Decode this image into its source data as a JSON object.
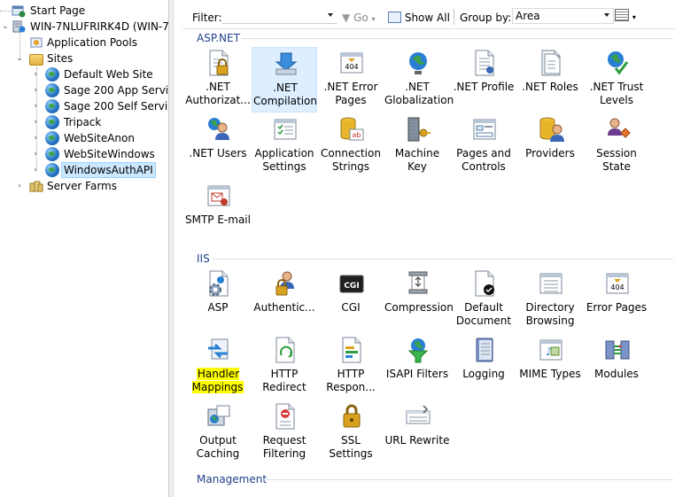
{
  "tree": {
    "nodes": [
      {
        "label": "Start Page"
      },
      {
        "label": "WIN-7NLUFRIRK4D (WIN-7NL"
      },
      {
        "label": "Application Pools"
      },
      {
        "label": "Sites"
      },
      {
        "label": "Default Web Site"
      },
      {
        "label": "Sage 200 App Services"
      },
      {
        "label": "Sage 200 Self Service"
      },
      {
        "label": "Tripack"
      },
      {
        "label": "WebSiteAnon"
      },
      {
        "label": "WebSiteWindows"
      },
      {
        "label": "WindowsAuthAPI"
      },
      {
        "label": "Server Farms"
      }
    ],
    "selected": "WindowsAuthAPI"
  },
  "filterbar": {
    "filter_label": "Filter:",
    "filter_value": "",
    "go_label": "Go",
    "show_all_label": "Show All",
    "group_by_label": "Group by:",
    "group_by_value": "Area"
  },
  "groups": {
    "aspnet": {
      "title": "ASP.NET",
      "items": [
        {
          "cap": ".NET Authorizat...",
          "icon": "lock-doc-icon"
        },
        {
          "cap": ".NET Compilation",
          "icon": "compile-icon"
        },
        {
          "cap": ".NET Error Pages",
          "icon": "error-404-icon"
        },
        {
          "cap": ".NET Globalization",
          "icon": "globe-icon"
        },
        {
          "cap": ".NET Profile",
          "icon": "profile-icon"
        },
        {
          "cap": ".NET Roles",
          "icon": "roles-icon"
        },
        {
          "cap": ".NET Trust Levels",
          "icon": "trust-icon"
        },
        {
          "cap": ".NET Users",
          "icon": "users-icon"
        },
        {
          "cap": "Application Settings",
          "icon": "app-settings-icon"
        },
        {
          "cap": "Connection Strings",
          "icon": "connection-icon"
        },
        {
          "cap": "Machine Key",
          "icon": "machine-key-icon"
        },
        {
          "cap": "Pages and Controls",
          "icon": "pages-controls-icon"
        },
        {
          "cap": "Providers",
          "icon": "providers-icon"
        },
        {
          "cap": "Session State",
          "icon": "session-state-icon"
        },
        {
          "cap": "SMTP E-mail",
          "icon": "smtp-icon"
        }
      ]
    },
    "iis": {
      "title": "IIS",
      "items": [
        {
          "cap": "ASP",
          "icon": "asp-icon"
        },
        {
          "cap": "Authentic...",
          "icon": "authentication-icon"
        },
        {
          "cap": "CGI",
          "icon": "cgi-icon"
        },
        {
          "cap": "Compression",
          "icon": "compression-icon"
        },
        {
          "cap": "Default Document",
          "icon": "default-document-icon"
        },
        {
          "cap": "Directory Browsing",
          "icon": "directory-browsing-icon"
        },
        {
          "cap": "Error Pages",
          "icon": "error-pages-icon"
        },
        {
          "cap": "Handler Mappings",
          "icon": "handler-mappings-icon"
        },
        {
          "cap": "HTTP Redirect",
          "icon": "http-redirect-icon"
        },
        {
          "cap": "HTTP Respon...",
          "icon": "http-response-icon"
        },
        {
          "cap": "ISAPI Filters",
          "icon": "isapi-filters-icon"
        },
        {
          "cap": "Logging",
          "icon": "logging-icon"
        },
        {
          "cap": "MIME Types",
          "icon": "mime-types-icon"
        },
        {
          "cap": "Modules",
          "icon": "modules-icon"
        },
        {
          "cap": "Output Caching",
          "icon": "output-caching-icon"
        },
        {
          "cap": "Request Filtering",
          "icon": "request-filtering-icon"
        },
        {
          "cap": "SSL Settings",
          "icon": "ssl-settings-icon"
        },
        {
          "cap": "URL Rewrite",
          "icon": "url-rewrite-icon"
        }
      ]
    },
    "management": {
      "title": "Management"
    }
  },
  "colors": {
    "group_title": "#1e3f8a",
    "selection": "#cce8ff",
    "highlight": "#ffff00"
  }
}
